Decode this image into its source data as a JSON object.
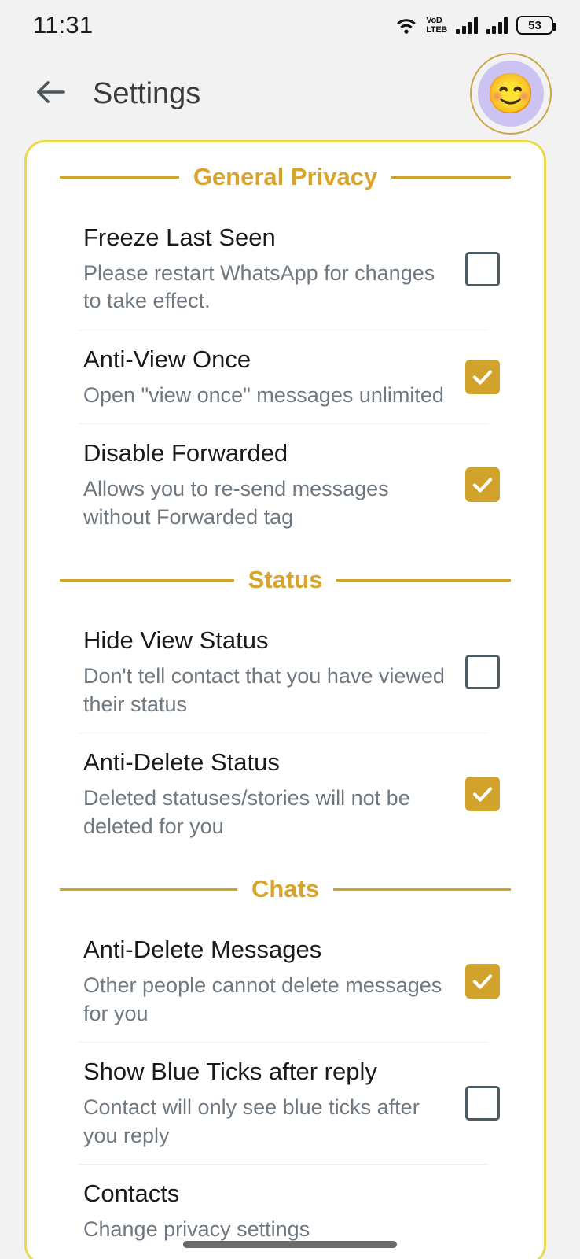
{
  "status_bar": {
    "time": "11:31",
    "battery_percent": "53",
    "volte_line1": "VoD",
    "volte_line2": "LTEB",
    "icons": [
      "wifi-icon",
      "volte-icon",
      "signal-bars-icon",
      "signal-bars-icon",
      "battery-icon"
    ]
  },
  "app_bar": {
    "back_label": "←",
    "title": "Settings",
    "avatar_emoji": "😊"
  },
  "colors": {
    "accent_gold": "#d9a42a",
    "rule_gold": "#cfa42e",
    "card_border": "#ecd84f",
    "checkbox_on": "#d1a32b",
    "checkbox_off_border": "#4b5a63",
    "background": "#f2f2f2",
    "avatar_ring": "#c9a84c",
    "avatar_bg": "#cdc3f2"
  },
  "sections": [
    {
      "title": "General Privacy",
      "items": [
        {
          "title": "Freeze Last Seen",
          "subtitle": "Please restart WhatsApp for changes to take effect.",
          "checked": false
        },
        {
          "title": "Anti-View Once",
          "subtitle": "Open \"view once\" messages unlimited",
          "checked": true
        },
        {
          "title": "Disable Forwarded",
          "subtitle": "Allows you to re-send messages without Forwarded tag",
          "checked": true
        }
      ]
    },
    {
      "title": "Status",
      "items": [
        {
          "title": "Hide View Status",
          "subtitle": "Don't tell contact that you have viewed their status",
          "checked": false
        },
        {
          "title": "Anti-Delete Status",
          "subtitle": "Deleted statuses/stories will not be deleted for you",
          "checked": true
        }
      ]
    },
    {
      "title": "Chats",
      "items": [
        {
          "title": "Anti-Delete Messages",
          "subtitle": "Other people cannot delete messages for you",
          "checked": true
        },
        {
          "title": "Show Blue Ticks after reply",
          "subtitle": "Contact will only see blue ticks after you reply",
          "checked": false
        },
        {
          "title": "Contacts",
          "subtitle": "Change privacy settings",
          "checked": null
        }
      ]
    }
  ]
}
